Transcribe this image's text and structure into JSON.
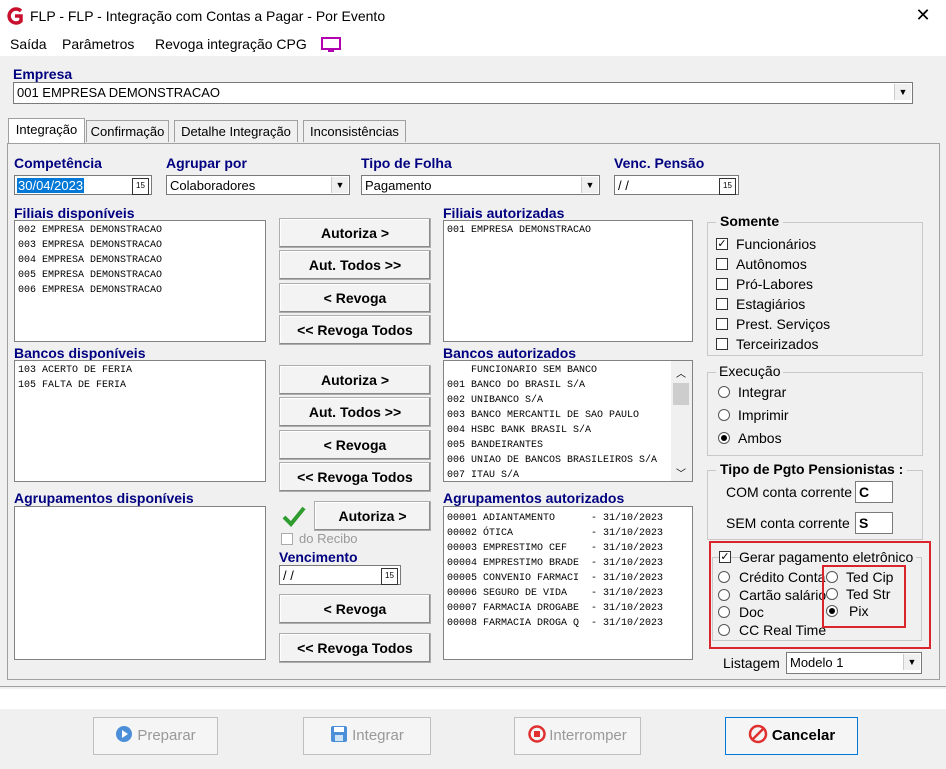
{
  "window": {
    "title": "FLP -  FLP - Integração com Contas a Pagar - Por Evento",
    "close_glyph": "✕"
  },
  "menu": {
    "items": [
      "Saída",
      "Parâmetros",
      "Revoga integração CPG"
    ]
  },
  "empresa": {
    "label": "Empresa",
    "value": "001 EMPRESA DEMONSTRACAO"
  },
  "tabs": [
    "Integração",
    "Confirmação",
    "Detalhe Integração",
    "Inconsistências"
  ],
  "fields": {
    "competencia": {
      "label": "Competência",
      "value": "30/04/2023"
    },
    "agrupar": {
      "label": "Agrupar por",
      "value": "Colaboradores"
    },
    "tipo_folha": {
      "label": "Tipo de Folha",
      "value": "Pagamento"
    },
    "venc_pensao": {
      "label": "Venc. Pensão",
      "value": " / /"
    },
    "vencimento": {
      "label": "Vencimento",
      "value": " / /"
    },
    "date_icon": "15"
  },
  "filiais_disponiveis": {
    "label": "Filiais disponíveis",
    "items": [
      "002 EMPRESA DEMONSTRACAO",
      "003 EMPRESA DEMONSTRACAO",
      "004 EMPRESA DEMONSTRACAO",
      "005 EMPRESA DEMONSTRACAO",
      "006 EMPRESA DEMONSTRACAO"
    ]
  },
  "filiais_autorizadas": {
    "label": "Filiais autorizadas",
    "items": [
      "001 EMPRESA DEMONSTRACAO"
    ]
  },
  "bancos_disponiveis": {
    "label": "Bancos disponíveis",
    "items": [
      "103 ACERTO DE FERIA",
      "105 FALTA DE FERIA"
    ]
  },
  "bancos_autorizados": {
    "label": "Bancos autorizados",
    "items": [
      "    FUNCIONARIO SEM BANCO",
      "001 BANCO DO BRASIL S/A",
      "002 UNIBANCO S/A",
      "003 BANCO MERCANTIL DE SAO PAULO",
      "004 HSBC BANK BRASIL S/A",
      "005 BANDEIRANTES",
      "006 UNIAO DE BANCOS BRASILEIROS S/A",
      "007 ITAU S/A"
    ]
  },
  "agrupamentos_disponiveis": {
    "label": "Agrupamentos disponíveis"
  },
  "agrupamentos_autorizados": {
    "label": "Agrupamentos autorizados",
    "items": [
      "00001 ADIANTAMENTO      - 31/10/2023",
      "00002 ÓTICA             - 31/10/2023",
      "00003 EMPRESTIMO CEF    - 31/10/2023",
      "00004 EMPRESTIMO BRADE  - 31/10/2023",
      "00005 CONVENIO FARMACI  - 31/10/2023",
      "00006 SEGURO DE VIDA    - 31/10/2023",
      "00007 FARMACIA DROGABE  - 31/10/2023",
      "00008 FARMACIA DROGA Q  - 31/10/2023"
    ]
  },
  "buttons": {
    "autoriza": "Autoriza >",
    "aut_todos": "Aut. Todos >>",
    "revoga": "< Revoga",
    "revoga_todos": "<< Revoga Todos",
    "do_recibo": "do Recibo"
  },
  "somente": {
    "title": "Somente",
    "items": [
      {
        "label": "Funcionários",
        "checked": true
      },
      {
        "label": "Autônomos",
        "checked": false
      },
      {
        "label": "Pró-Labores",
        "checked": false
      },
      {
        "label": "Estagiários",
        "checked": false
      },
      {
        "label": "Prest. Serviços",
        "checked": false
      },
      {
        "label": "Terceirizados",
        "checked": false
      }
    ]
  },
  "execucao": {
    "title": "Execução",
    "items": [
      "Integrar",
      "Imprimir",
      "Ambos"
    ],
    "selected": "Ambos"
  },
  "tipo_pgto": {
    "title": "Tipo de Pgto Pensionistas :",
    "com_label": "COM conta corrente",
    "com_value": "C",
    "sem_label": "SEM conta corrente",
    "sem_value": "S"
  },
  "pagamento": {
    "gerar_label": "Gerar pagamento eletrônico",
    "left": [
      "Crédito Conta",
      "Cartão salário",
      "Doc",
      "CC Real Time"
    ],
    "right": [
      "Ted Cip",
      "Ted Str",
      "Pix"
    ],
    "selected": "Pix"
  },
  "listagem": {
    "label": "Listagem",
    "value": "Modelo 1"
  },
  "footer": {
    "preparar": "Preparar",
    "integrar": "Integrar",
    "interromper": "Interromper",
    "cancelar": "Cancelar"
  },
  "colors": {
    "accent_label": "#000080",
    "highlight": "#d9262c",
    "check": "#2e9c2e"
  }
}
